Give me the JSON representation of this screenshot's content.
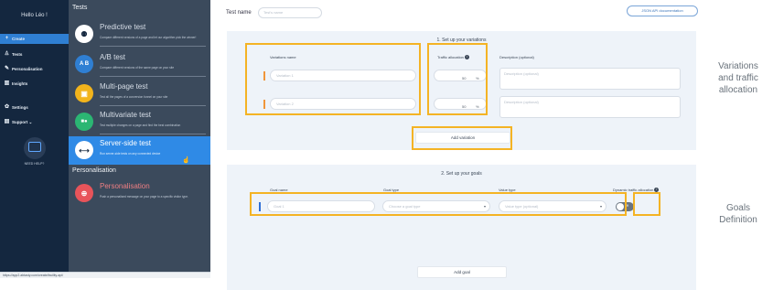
{
  "nav": {
    "greeting": "Hello Léo !",
    "items": [
      {
        "label": "Create",
        "icon": "+"
      },
      {
        "label": "Tests",
        "icon": "♙"
      },
      {
        "label": "Personalisation",
        "icon": "✎"
      },
      {
        "label": "Insights",
        "icon": "▥"
      },
      {
        "label": "Settings",
        "icon": "✿"
      },
      {
        "label": "Support  ⌄",
        "icon": "▤"
      }
    ],
    "help_label": "NEED HELP?"
  },
  "tests_panel": {
    "title": "Tests",
    "items": [
      {
        "title": "Predictive test",
        "desc": "Compare different versions of a page and let our algorithm pick the winner!",
        "icon": "⚉",
        "color": "#ffffff"
      },
      {
        "title": "A/B test",
        "desc": "Compare different versions of the same page on your site",
        "icon": "A B",
        "color": "#2f7fd3"
      },
      {
        "title": "Multi-page test",
        "desc": "Test all the pages of a conversion funnel on your site",
        "icon": "▣",
        "color": "#f2b41c"
      },
      {
        "title": "Multivariate test",
        "desc": "Test multiple changes on a page and find the best combination",
        "icon": "■●",
        "color": "#2bb673"
      },
      {
        "title": "Server-side test",
        "desc": "Run server-side tests on any connected device",
        "icon": "⟷",
        "color": "#ffffff"
      }
    ],
    "personalisation_heading": "Personalisation",
    "personalisation_item": {
      "title": "Personalisation",
      "desc": "Push a personalised message on your page to a specific visitor type.",
      "icon": "⊕",
      "color": "#e8545a"
    }
  },
  "statusbar": "https://app2.abtasty.com/create/facility-api/",
  "main": {
    "test_name_label": "Test name",
    "test_name_placeholder": "Test's name",
    "json_button": "JSON API documentation",
    "section1": {
      "title": "1. Set up your variations",
      "col_variations": "Variations name",
      "col_traffic": "Traffic allocation",
      "col_description": "Description (optional)",
      "rows": [
        {
          "name": "Variation 1",
          "traffic": "50",
          "unit": "%",
          "desc": "Description (optional)"
        },
        {
          "name": "Variation 2",
          "traffic": "50",
          "unit": "%",
          "desc": "Description (optional)"
        }
      ],
      "add_button": "Add variation"
    },
    "section2": {
      "title": "2. Set up your goals",
      "col_goal_name": "Goal name",
      "col_goal_type": "Goal type",
      "col_value_type": "Value type",
      "col_dynamic": "Dynamic traffic allocation",
      "goal_placeholder": "Goal 1",
      "goal_type_placeholder": "Choose a goal type",
      "value_type_placeholder": "Value type (optional)",
      "toggle_label": "off",
      "add_button": "Add goal"
    }
  },
  "captions": {
    "variations": [
      "Variations",
      "and traffic",
      "allocation"
    ],
    "goals": [
      "Goals",
      "Definition"
    ]
  },
  "colors": {
    "highlight": "#f4b324",
    "accent": "#2f8ae6",
    "orange_marker": "#f0953a",
    "blue_marker": "#2f6fd6"
  }
}
